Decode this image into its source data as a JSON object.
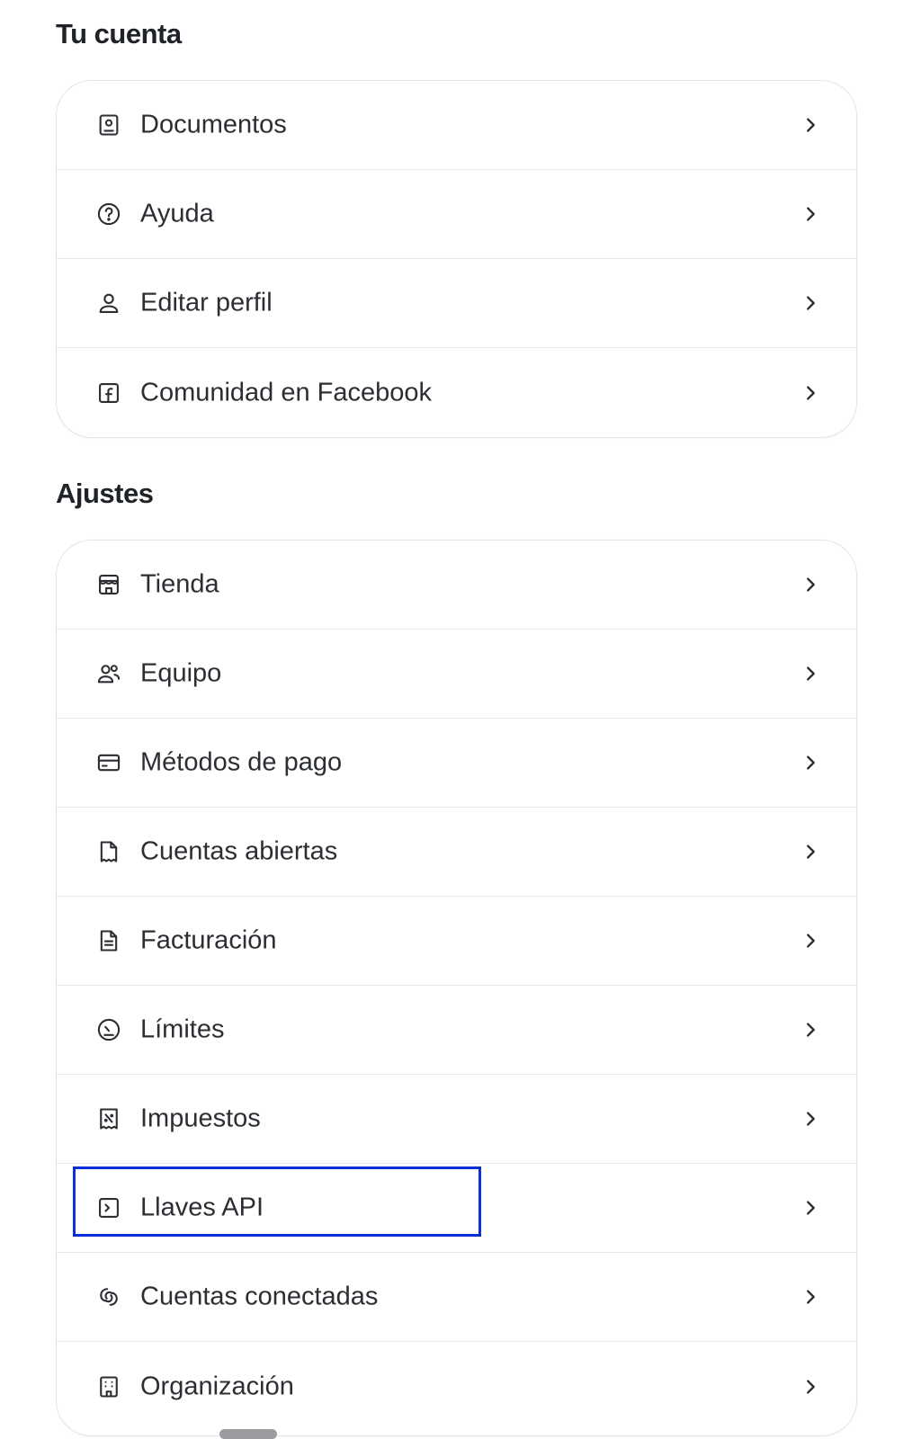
{
  "sections": [
    {
      "title": "Tu cuenta",
      "items": [
        {
          "label": "Documentos",
          "icon": "document-profile-icon"
        },
        {
          "label": "Ayuda",
          "icon": "help-circle-icon"
        },
        {
          "label": "Editar perfil",
          "icon": "user-icon"
        },
        {
          "label": "Comunidad en Facebook",
          "icon": "facebook-icon"
        }
      ]
    },
    {
      "title": "Ajustes",
      "items": [
        {
          "label": "Tienda",
          "icon": "store-icon"
        },
        {
          "label": "Equipo",
          "icon": "team-icon"
        },
        {
          "label": "Métodos de pago",
          "icon": "credit-card-icon"
        },
        {
          "label": "Cuentas abiertas",
          "icon": "receipt-icon"
        },
        {
          "label": "Facturación",
          "icon": "invoice-icon"
        },
        {
          "label": "Límites",
          "icon": "gauge-icon"
        },
        {
          "label": "Impuestos",
          "icon": "tax-receipt-icon"
        },
        {
          "label": "Llaves API",
          "icon": "terminal-icon"
        },
        {
          "label": "Cuentas conectadas",
          "icon": "link-icon"
        },
        {
          "label": "Organización",
          "icon": "building-icon"
        }
      ]
    }
  ],
  "highlighted_item": "Llaves API",
  "colors": {
    "text": "#2b2f33",
    "border": "#e3e4e6",
    "highlight": "#0b2fd8",
    "icon": "#2b2f33"
  }
}
